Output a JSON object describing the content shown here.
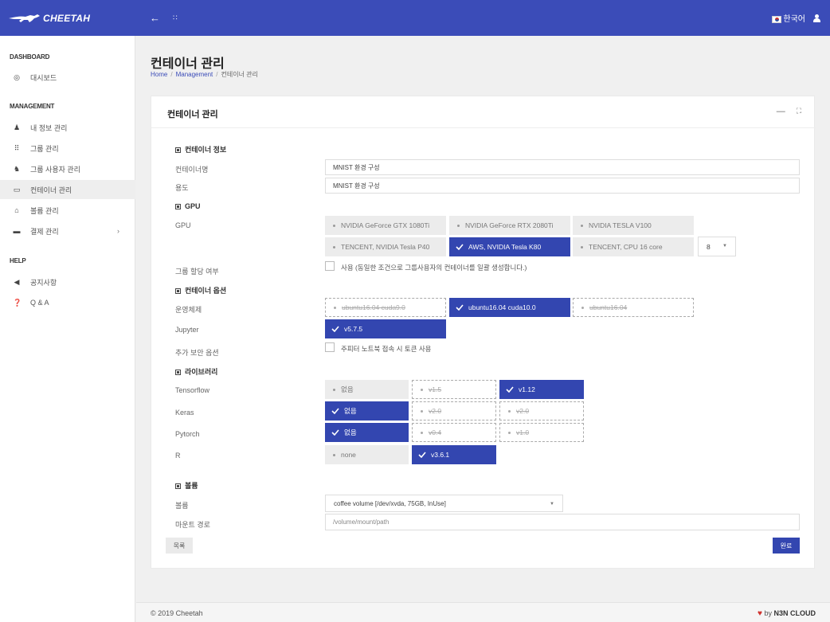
{
  "app": {
    "brand_bold": "CHEETAH",
    "brand_light": "",
    "language": "한국어"
  },
  "sidebar": {
    "sections": [
      {
        "title": "DASHBOARD"
      },
      {
        "title": "MANAGEMENT"
      },
      {
        "title": "HELP"
      }
    ],
    "items": [
      {
        "label": "대시보드",
        "icon": "dashboard-icon"
      },
      {
        "label": "내 정보 관리",
        "icon": "user-icon"
      },
      {
        "label": "그룹 관리",
        "icon": "grid-icon"
      },
      {
        "label": "그룹 사용자 관리",
        "icon": "users-icon"
      },
      {
        "label": "컨테이너 관리",
        "icon": "monitor-icon",
        "active": true
      },
      {
        "label": "볼륨 관리",
        "icon": "disk-icon"
      },
      {
        "label": "결제 관리",
        "icon": "card-icon",
        "arrow": "›"
      },
      {
        "label": "공지사항",
        "icon": "megaphone-icon"
      },
      {
        "label": "Q & A",
        "icon": "question-icon"
      }
    ]
  },
  "page": {
    "title": "컨테이너 관리",
    "breadcrumb": [
      "Home",
      "Management",
      "컨테이너 관리"
    ]
  },
  "card": {
    "title": "컨테이너 관리",
    "sections": {
      "info": "컨테이너 정보",
      "gpu": "GPU",
      "options": "컨테이너 옵션",
      "library": "라이브러리",
      "volume": "볼륨"
    },
    "labels": {
      "name": "컨테이너명",
      "purpose": "용도",
      "gpu": "GPU",
      "group_alloc": "그룹 할당 여부",
      "os": "운영체제",
      "jupyter": "Jupyter",
      "security": "추가 보안 옵션",
      "tensorflow": "Tensorflow",
      "keras": "Keras",
      "pytorch": "Pytorch",
      "r": "R",
      "volume": "볼륨",
      "mount": "마운트 경로"
    },
    "values": {
      "name": "MNIST 환경 구성",
      "purpose": "MNIST 환경 구성",
      "mount_placeholder": "/volume/mount/path",
      "volume_select": "coffee volume [/dev/xvda, 75GB, InUse]",
      "gpu_count": "8"
    },
    "gpu_options": [
      {
        "label": "NVIDIA GeForce GTX 1080Ti",
        "state": "normal"
      },
      {
        "label": "NVIDIA GeForce RTX 2080Ti",
        "state": "normal"
      },
      {
        "label": "NVIDIA TESLA V100",
        "state": "normal"
      },
      {
        "label": "TENCENT, NVIDIA Tesla P40",
        "state": "normal"
      },
      {
        "label": "AWS, NVIDIA Tesla K80",
        "state": "selected"
      },
      {
        "label": "TENCENT, CPU 16 core",
        "state": "normal"
      }
    ],
    "group_alloc_text": "사용 (동일한 조건으로 그룹사용자의 컨테이너를 일괄 생성합니다.)",
    "os_options": [
      {
        "label": "ubuntu16.04 cuda9.0",
        "state": "disabled"
      },
      {
        "label": "ubuntu16.04 cuda10.0",
        "state": "selected"
      },
      {
        "label": "ubuntu16.04",
        "state": "disabled"
      }
    ],
    "jupyter_options": [
      {
        "label": "v5.7.5",
        "state": "selected"
      }
    ],
    "security_text": "주피터 노트북 접속 시 토큰 사용",
    "tensorflow_options": [
      {
        "label": "없음",
        "state": "normal"
      },
      {
        "label": "v1.5",
        "state": "disabled"
      },
      {
        "label": "v1.12",
        "state": "selected"
      }
    ],
    "keras_options": [
      {
        "label": "없음",
        "state": "selected"
      },
      {
        "label": "v2.0",
        "state": "disabled"
      },
      {
        "label": "v2.0",
        "state": "disabled"
      }
    ],
    "pytorch_options": [
      {
        "label": "없음",
        "state": "selected"
      },
      {
        "label": "v0.4",
        "state": "disabled"
      },
      {
        "label": "v1.0",
        "state": "disabled"
      }
    ],
    "r_options": [
      {
        "label": "none",
        "state": "normal"
      },
      {
        "label": "v3.6.1",
        "state": "selected"
      }
    ],
    "buttons": {
      "list": "목록",
      "done": "완료"
    }
  },
  "footer": {
    "copyright": "© 2019 Cheetah",
    "by": "by",
    "company": "N3N CLOUD"
  },
  "colors": {
    "primary": "#3b4cb8",
    "selected": "#3346b0",
    "heart": "#d0312d"
  }
}
